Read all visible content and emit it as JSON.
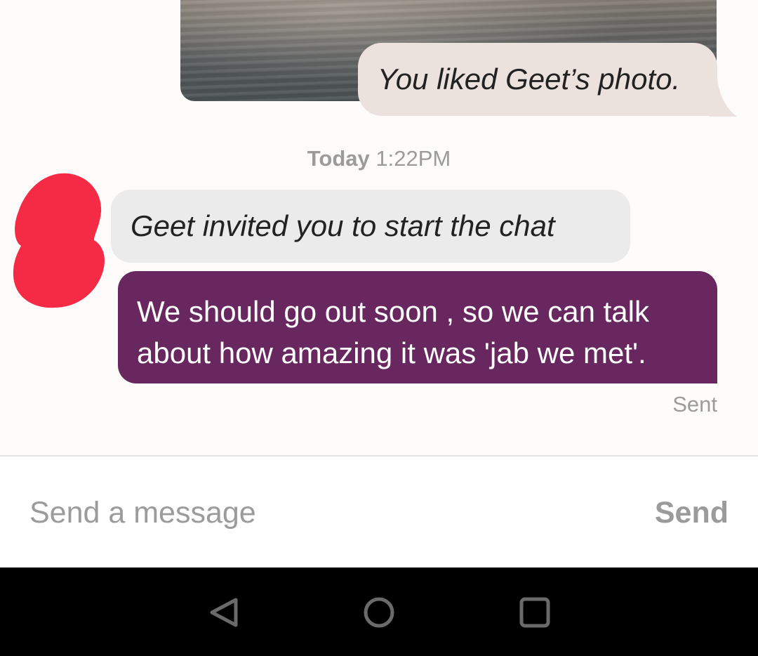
{
  "conversation": {
    "liked_photo_text": "You liked Geet’s photo.",
    "timestamp_day": "Today",
    "timestamp_time": "1:22PM",
    "invite_text": "Geet invited you to start the chat",
    "sent_message": "We should go out soon , so we can talk about how amazing it was 'jab we met'.",
    "sent_status": "Sent",
    "colors": {
      "sent_bubble": "#68275e",
      "liked_bubble": "#ece2dd",
      "invite_bubble": "#ebebeb",
      "avatar_redaction": "#f52a44"
    }
  },
  "composer": {
    "placeholder": "Send a message",
    "value": "",
    "send_label": "Send"
  },
  "navigation_bar": {
    "icons": [
      "back-triangle-icon",
      "home-circle-icon",
      "recents-square-icon"
    ]
  }
}
